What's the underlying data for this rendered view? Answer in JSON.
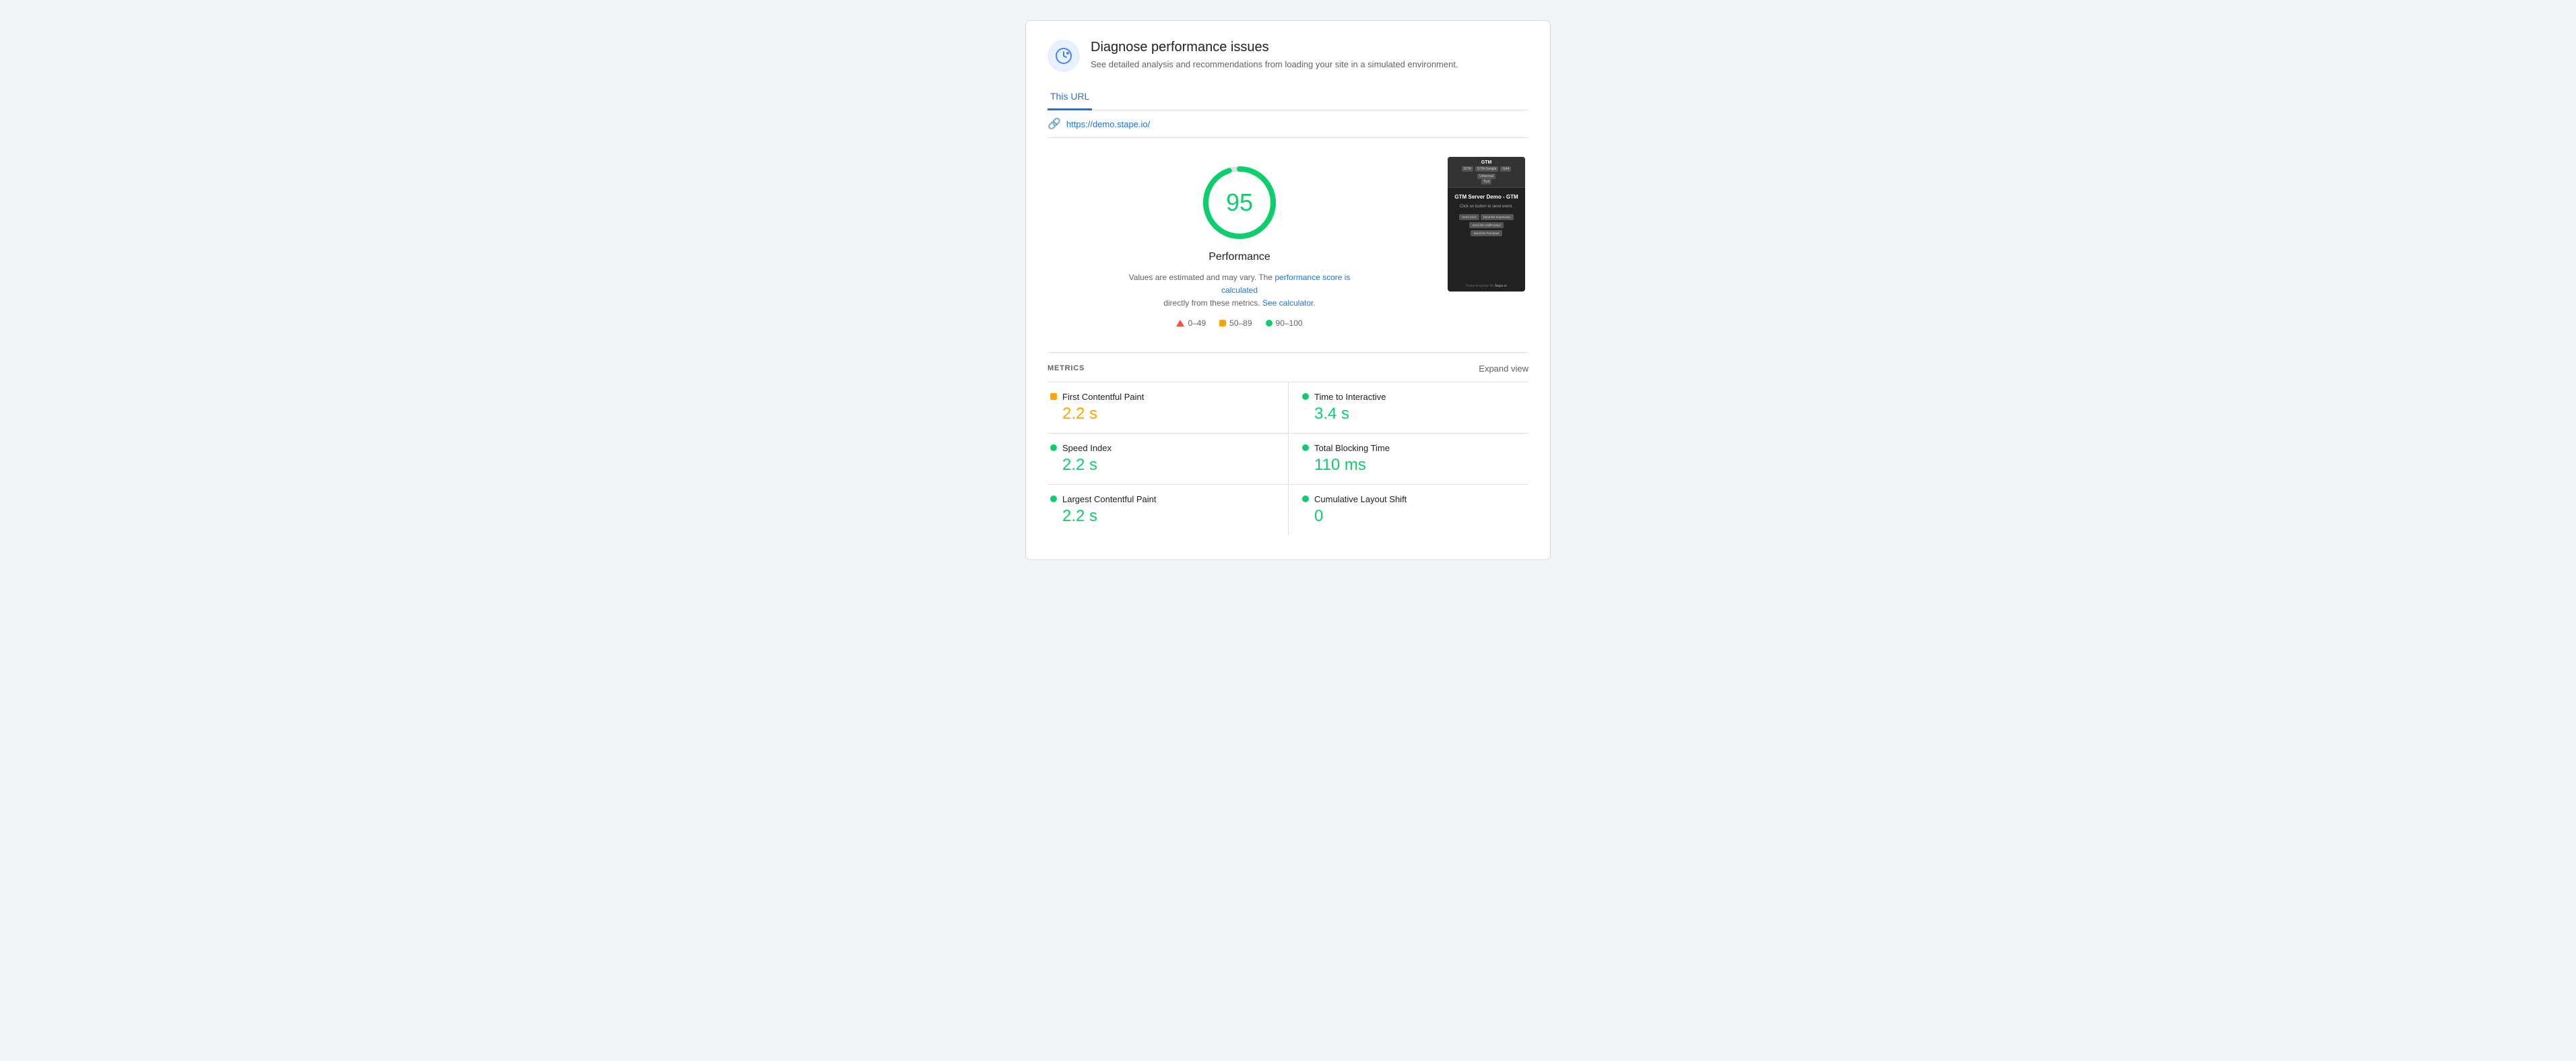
{
  "header": {
    "title": "Diagnose performance issues",
    "description": "See detailed analysis and recommendations from loading your site in a simulated environment.",
    "icon_alt": "performance-icon"
  },
  "tabs": [
    {
      "label": "This URL",
      "active": true
    }
  ],
  "url_bar": {
    "url": "https://demo.stape.io/"
  },
  "score": {
    "value": "95",
    "label": "Performance",
    "note_text": "Values are estimated and may vary. The",
    "link1_text": "performance score is calculated",
    "note_mid": "directly from these metrics.",
    "link2_text": "See calculator",
    "link2_suffix": "."
  },
  "legend": [
    {
      "type": "triangle",
      "color": "#ff4e42",
      "label": "0–49"
    },
    {
      "type": "square",
      "color": "#ffa400",
      "label": "50–89"
    },
    {
      "type": "circle",
      "color": "#0cce6b",
      "label": "90–100"
    }
  ],
  "screenshot": {
    "top_title": "GTM",
    "tags": [
      "GTM",
      "GTM Google",
      "GA4",
      "Universal",
      "Tool"
    ],
    "page_title": "GTM Server Demo - GTM",
    "page_subtitle": "Click on button to send event.",
    "buttons": [
      [
        "Send Click",
        "Send EE Impression"
      ],
      [
        "Send EE AddProduct"
      ],
      [
        "Send EE Purchase"
      ]
    ],
    "footer": "Demo template for Stape.io"
  },
  "metrics": {
    "section_title": "METRICS",
    "expand_label": "Expand view",
    "items": [
      {
        "name": "First Contentful Paint",
        "value": "2.2 s",
        "color_class": "orange",
        "dot_type": "square",
        "dot_color": "#ffa400",
        "side": "left"
      },
      {
        "name": "Time to Interactive",
        "value": "3.4 s",
        "color_class": "green",
        "dot_type": "circle",
        "dot_color": "#0cce6b",
        "side": "right"
      },
      {
        "name": "Speed Index",
        "value": "2.2 s",
        "color_class": "green",
        "dot_type": "circle",
        "dot_color": "#0cce6b",
        "side": "left"
      },
      {
        "name": "Total Blocking Time",
        "value": "110 ms",
        "color_class": "green",
        "dot_type": "circle",
        "dot_color": "#0cce6b",
        "side": "right"
      },
      {
        "name": "Largest Contentful Paint",
        "value": "2.2 s",
        "color_class": "green",
        "dot_type": "circle",
        "dot_color": "#0cce6b",
        "side": "left"
      },
      {
        "name": "Cumulative Layout Shift",
        "value": "0",
        "color_class": "green",
        "dot_type": "circle",
        "dot_color": "#0cce6b",
        "side": "right"
      }
    ]
  }
}
